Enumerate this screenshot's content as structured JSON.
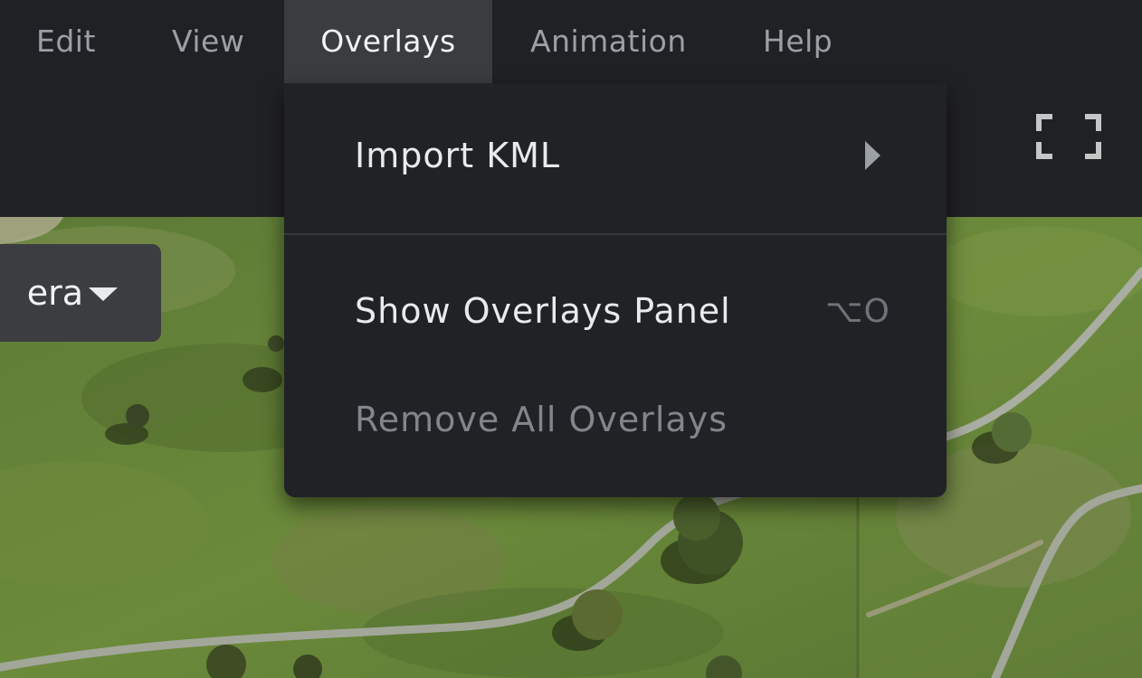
{
  "menubar": {
    "items": [
      {
        "label": "Edit",
        "active": false
      },
      {
        "label": "View",
        "active": false
      },
      {
        "label": "Overlays",
        "active": true
      },
      {
        "label": "Animation",
        "active": false
      },
      {
        "label": "Help",
        "active": false
      }
    ]
  },
  "toolbar": {
    "fullscreen_icon": "fullscreen-icon"
  },
  "camera_select": {
    "label": "era",
    "icon": "caret-down-icon"
  },
  "overlays_menu": {
    "items": [
      {
        "label": "Import KML",
        "submenu": true,
        "enabled": true
      },
      {
        "label": "Show Overlays Panel",
        "shortcut": "⌥O",
        "enabled": true
      },
      {
        "label": "Remove All Overlays",
        "enabled": false
      }
    ]
  },
  "colors": {
    "chrome_bg": "#202124",
    "menu_active_bg": "#3a3c40",
    "dropdown_bg": "#212226",
    "text_primary": "#e8eaed",
    "text_muted": "#9aa0a6",
    "text_disabled": "#80868b"
  }
}
